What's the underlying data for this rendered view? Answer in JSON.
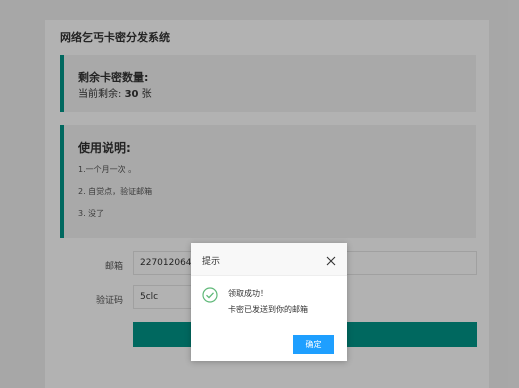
{
  "site_title": "网络乞丐卡密分发系统",
  "remain": {
    "label": "剩余卡密数量:",
    "current_prefix": "当前剩余:",
    "count": "30",
    "unit": "张"
  },
  "usage": {
    "title": "使用说明:",
    "items": [
      "1.一个月一次 。",
      "2. 自觉点，验证邮箱",
      "3. 没了"
    ]
  },
  "form": {
    "email_label": "邮箱",
    "email_value": "2270120640",
    "captcha_label": "验证码",
    "captcha_value": "5clc",
    "submit_label": ""
  },
  "dialog": {
    "title": "提示",
    "message1": "领取成功！",
    "message2": "卡密已发送到你的邮箱",
    "ok_label": "确定",
    "icon": "check-circle-icon",
    "close_icon": "close-icon"
  },
  "colors": {
    "accent": "#009688",
    "dialog_button": "#1e9fff",
    "overlay": "rgba(0,0,0,0.3)"
  }
}
